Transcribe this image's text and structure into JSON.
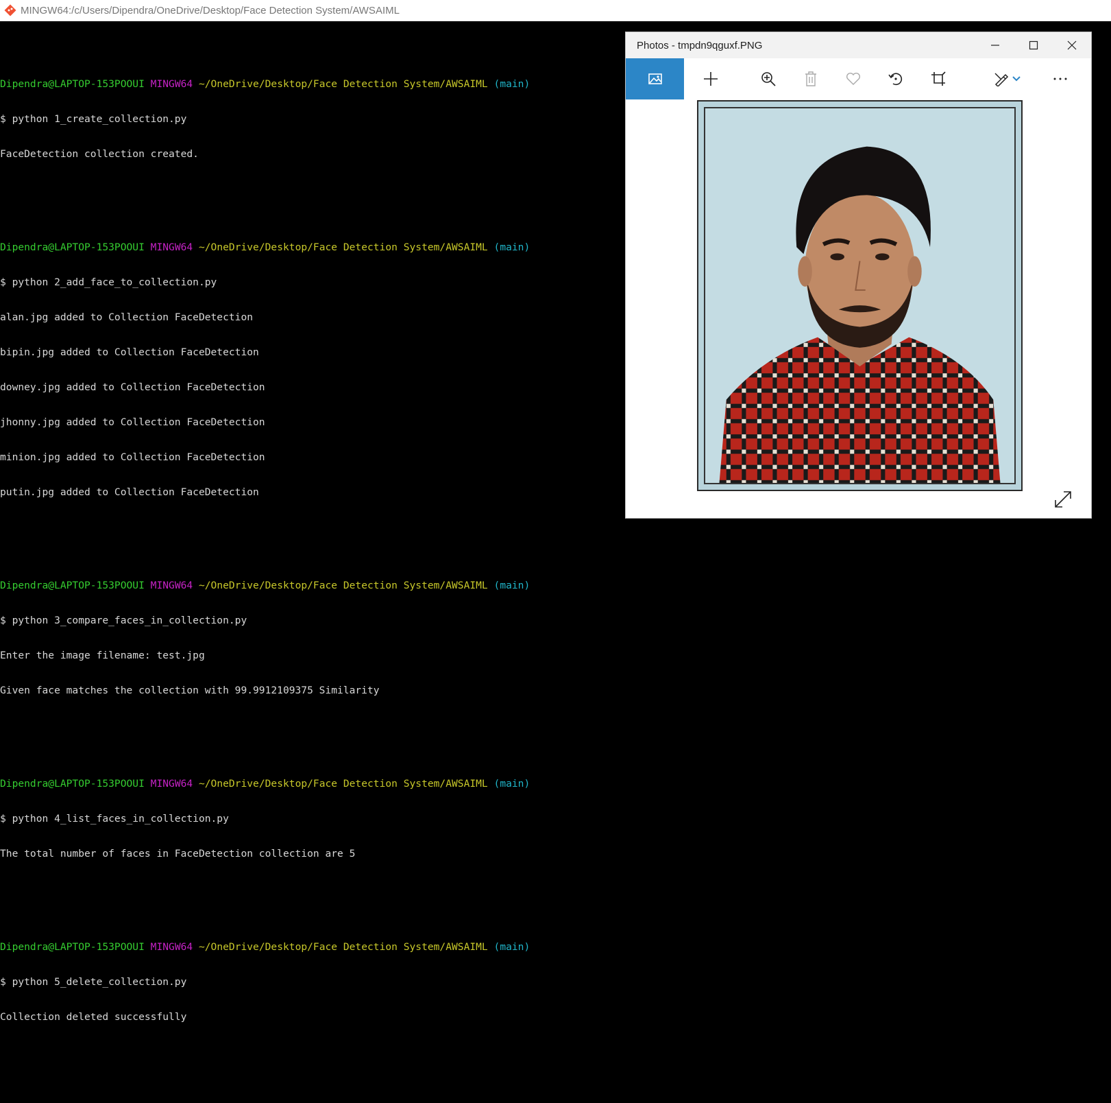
{
  "window": {
    "title": "MINGW64:/c/Users/Dipendra/OneDrive/Desktop/Face Detection System/AWSAIML"
  },
  "prompt": {
    "user": "Dipendra@LAPTOP-153POOUI",
    "system": "MINGW64",
    "path": "~/OneDrive/Desktop/Face Detection System/AWSAIML",
    "branch": "(main)"
  },
  "terminal": {
    "blocks": [
      {
        "command": "$ python 1_create_collection.py",
        "output": [
          "FaceDetection collection created."
        ]
      },
      {
        "command": "$ python 2_add_face_to_collection.py",
        "output": [
          "alan.jpg added to Collection FaceDetection",
          "bipin.jpg added to Collection FaceDetection",
          "downey.jpg added to Collection FaceDetection",
          "jhonny.jpg added to Collection FaceDetection",
          "minion.jpg added to Collection FaceDetection",
          "putin.jpg added to Collection FaceDetection"
        ]
      },
      {
        "command": "$ python 3_compare_faces_in_collection.py",
        "output": [
          "Enter the image filename: test.jpg",
          "Given face matches the collection with 99.9912109375 Similarity"
        ]
      },
      {
        "command": "$ python 4_list_faces_in_collection.py",
        "output": [
          "The total number of faces in FaceDetection collection are 5"
        ]
      },
      {
        "command": "$ python 5_delete_collection.py",
        "output": [
          "Collection deleted successfully"
        ]
      }
    ],
    "final_prompt": "$ "
  },
  "photos": {
    "title": "Photos - tmpdn9qguxf.PNG",
    "toolbar_icons": [
      "image-icon",
      "add-icon",
      "zoom-in-icon",
      "delete-icon",
      "favorite-icon",
      "rotate-icon",
      "crop-icon",
      "edit-draw-icon",
      "chevron-down-icon",
      "more-icon"
    ],
    "accent": "#2c86c7"
  }
}
